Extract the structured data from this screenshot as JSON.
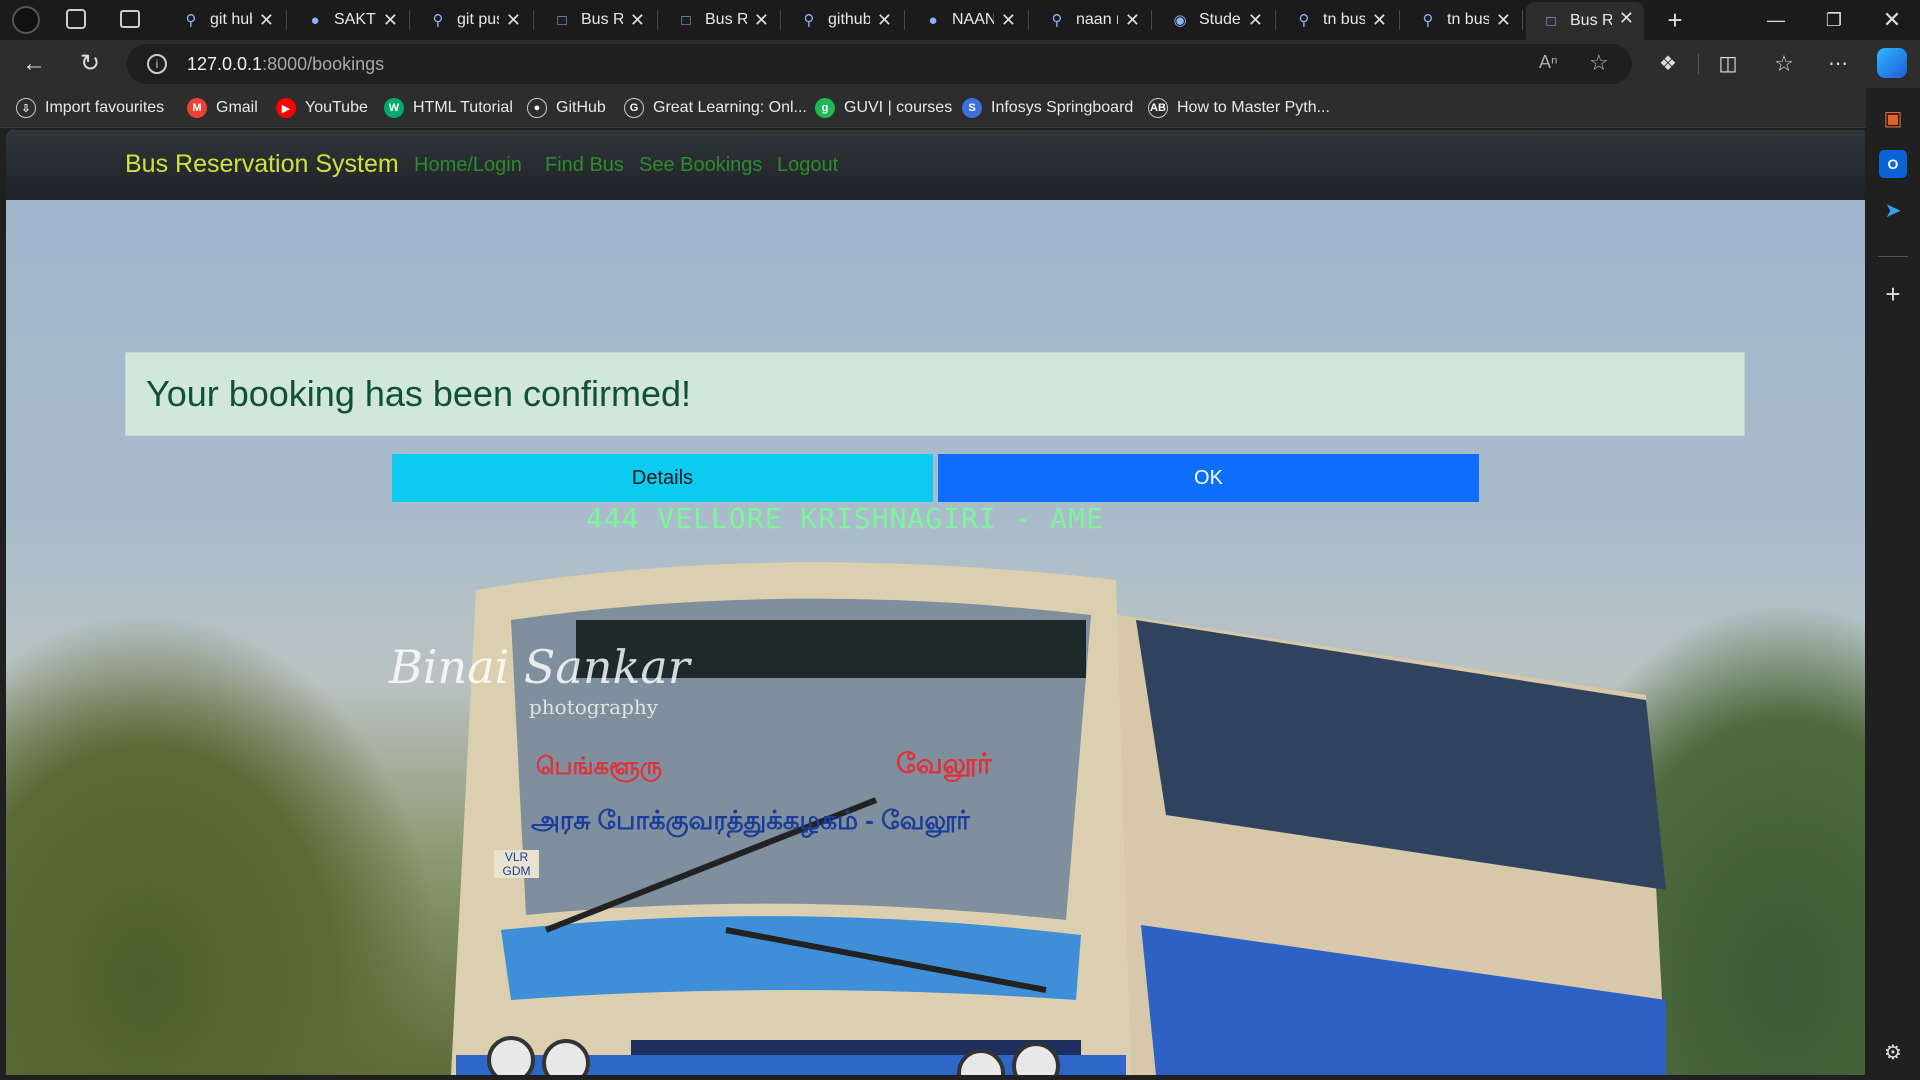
{
  "browser": {
    "tabs": [
      {
        "icon": "search-icon",
        "title": "git hub"
      },
      {
        "icon": "github-icon",
        "title": "SAKTH"
      },
      {
        "icon": "search-icon",
        "title": "git pus"
      },
      {
        "icon": "page-icon",
        "title": "Bus Re"
      },
      {
        "icon": "page-icon",
        "title": "Bus Re"
      },
      {
        "icon": "search-icon",
        "title": "github"
      },
      {
        "icon": "github-icon",
        "title": "NAAN"
      },
      {
        "icon": "search-icon",
        "title": "naan m"
      },
      {
        "icon": "student-icon",
        "title": "Studen"
      },
      {
        "icon": "search-icon",
        "title": "tn bus"
      },
      {
        "icon": "search-icon",
        "title": "tn bus"
      },
      {
        "icon": "page-icon",
        "title": "Bus Re"
      }
    ],
    "address": {
      "host": "127.0.0.1",
      "path": ":8000/bookings"
    },
    "bookmarks": [
      {
        "icon": "import-icon",
        "label": "Import favourites",
        "color": "#ffffff"
      },
      {
        "icon": "gmail-icon",
        "label": "Gmail",
        "color": "#ea4335"
      },
      {
        "icon": "youtube-icon",
        "label": "YouTube",
        "color": "#ff0000"
      },
      {
        "icon": "w3schools-icon",
        "label": "HTML Tutorial",
        "color": "#04aa6d"
      },
      {
        "icon": "github-icon",
        "label": "GitHub",
        "color": "#ffffff"
      },
      {
        "icon": "great-learning-icon",
        "label": "Great Learning: Onl...",
        "color": "#ffffff"
      },
      {
        "icon": "guvi-icon",
        "label": "GUVI | courses",
        "color": "#1db954"
      },
      {
        "icon": "springboard-icon",
        "label": "Infosys Springboard",
        "color": "#3f6fd8"
      },
      {
        "icon": "ab-icon",
        "label": "How to Master Pyth...",
        "color": "#ffffff"
      }
    ]
  },
  "page": {
    "brand": "Bus Reservation System",
    "nav": [
      "Home/Login",
      "Find Bus",
      "See Bookings",
      "Logout"
    ],
    "alert": "Your booking has been confirmed!",
    "buttons": {
      "details": "Details",
      "ok": "OK"
    },
    "colors": {
      "brand": "#cfe23a",
      "nav_link": "#2e8b2e",
      "alert_bg": "#d1e7dd",
      "alert_text": "#0f5132",
      "details_bg": "#0dcaf0",
      "ok_bg": "#0d6efd"
    },
    "background_image": {
      "route_sign": "444  VELLORE  KRISHNAGIRI - AME",
      "tamil_left": "பெங்களூரு",
      "tamil_right": "வேலூர்",
      "tamil_bottom": "அரசு போக்குவரத்துக்கழகம் - வேலூர்",
      "plate": "VLR GDM",
      "watermark": "Binai Sankar",
      "watermark_sub": "photography"
    }
  }
}
